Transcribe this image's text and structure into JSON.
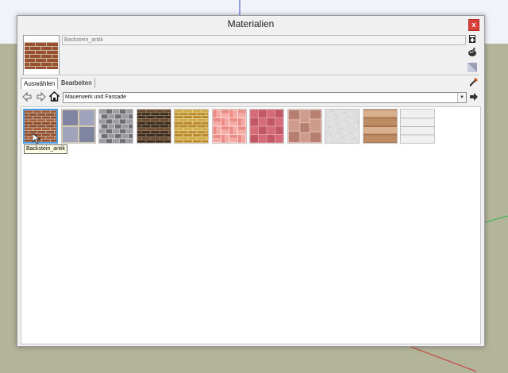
{
  "window": {
    "title": "Materialien",
    "close_label": "x"
  },
  "current_material": {
    "name": "Backstein_antik"
  },
  "side_tools": [
    {
      "icon": "create-material-icon"
    },
    {
      "icon": "display-secondary-pane-icon"
    },
    {
      "icon": "default-material-icon"
    }
  ],
  "tabs": [
    {
      "label": "Auswählen",
      "active": true
    },
    {
      "label": "Bearbeiten",
      "active": false
    }
  ],
  "sample_paint_icon": "eyedropper-icon",
  "navigation": {
    "back_icon": "arrow-left-icon",
    "forward_icon": "arrow-right-icon",
    "home_icon": "home-icon",
    "collection": "Mauerwerk und Fassade",
    "details_icon": "details-arrow-icon"
  },
  "materials": [
    {
      "name": "Backstein_antik",
      "selected": true,
      "pattern": "brick",
      "colors": [
        "#8f4a2b",
        "#a65a36",
        "#c9b9a4"
      ]
    },
    {
      "name": "",
      "pattern": "stone-blocks",
      "colors": [
        "#7f84a0",
        "#9fa3bb",
        "#d7ccb0"
      ]
    },
    {
      "name": "",
      "pattern": "stone",
      "colors": [
        "#6f6f74",
        "#9a9aa0",
        "#cfcfd2"
      ]
    },
    {
      "name": "",
      "pattern": "brick",
      "colors": [
        "#3e2b1f",
        "#6b4a30",
        "#8c7a62"
      ]
    },
    {
      "name": "",
      "pattern": "brick",
      "colors": [
        "#b8892d",
        "#d2a948",
        "#e4cf8a"
      ]
    },
    {
      "name": "",
      "pattern": "basket",
      "colors": [
        "#ec8a86",
        "#f4a9a6",
        "#fbd2c8"
      ]
    },
    {
      "name": "",
      "pattern": "pavers",
      "colors": [
        "#c25866",
        "#d46b77",
        "#e49aa2"
      ]
    },
    {
      "name": "",
      "pattern": "flagstone",
      "colors": [
        "#b77f72",
        "#cf9b8d",
        "#e5c0b3"
      ]
    },
    {
      "name": "",
      "pattern": "concrete",
      "colors": [
        "#cdcdcd",
        "#dedede",
        "#eeeeee"
      ]
    },
    {
      "name": "",
      "pattern": "siding",
      "colors": [
        "#a6734f",
        "#be8c64",
        "#d9b08d"
      ]
    },
    {
      "name": "",
      "pattern": "panel",
      "colors": [
        "#e3e3e3",
        "#f0f0f0",
        "#b9b9b9"
      ]
    }
  ],
  "tooltip": "Backstein_antik"
}
